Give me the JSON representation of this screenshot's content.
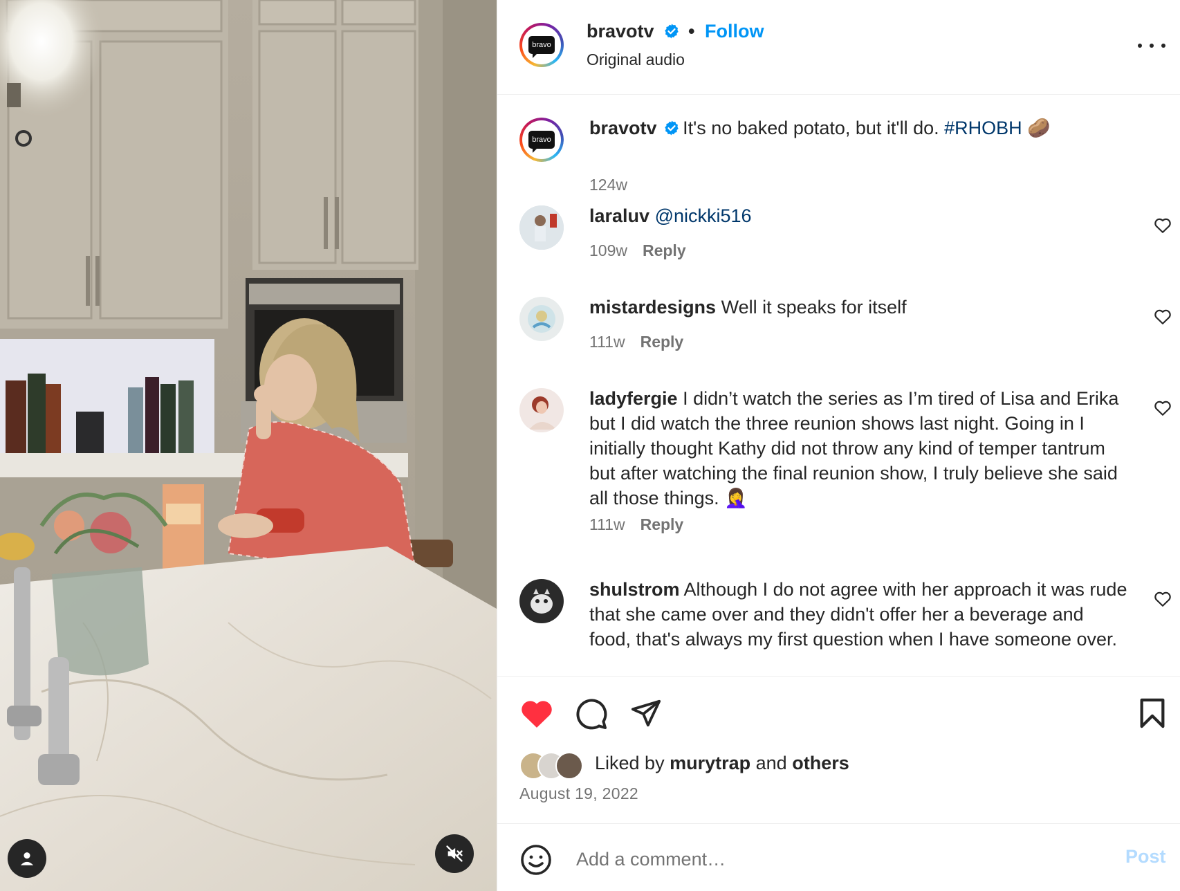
{
  "header": {
    "username": "bravotv",
    "separator": "•",
    "follow_label": "Follow",
    "subtitle": "Original audio",
    "avatar_text": "bravo"
  },
  "caption": {
    "username": "bravotv",
    "text": "It's no baked potato, but it'll do.",
    "hashtag": "#RHOBH",
    "emoji": "🥔",
    "time": "124w"
  },
  "comments": [
    {
      "username": "laraluv",
      "mention": "@nickki516",
      "text": "",
      "time": "109w",
      "reply_label": "Reply"
    },
    {
      "username": "mistardesigns",
      "text": "Well it speaks for itself",
      "time": "111w",
      "reply_label": "Reply"
    },
    {
      "username": "ladyfergie",
      "text": "I didn’t watch the series as I’m tired of Lisa and Erika but I did watch the three reunion shows last night. Going in I initially thought Kathy did not throw any kind of temper tantrum but after watching the final reunion show, I truly believe she said all those things. 🤦‍♀️",
      "time": "111w",
      "reply_label": "Reply"
    },
    {
      "username": "shulstrom",
      "text": "Although I do not agree with her approach it was rude that she came over and they didn't offer her a beverage and food, that's always my first question when I have someone over.",
      "time": "",
      "reply_label": ""
    }
  ],
  "likes": {
    "prefix": "Liked by",
    "user": "murytrap",
    "middle": "and",
    "others": "others"
  },
  "post_date": "August 19, 2022",
  "composer": {
    "placeholder": "Add a comment…",
    "post_label": "Post"
  },
  "icons": {
    "verified": "verified-badge-icon",
    "like": "heart-filled-icon",
    "comment": "comment-bubble-icon",
    "share": "paper-plane-icon",
    "save": "bookmark-icon",
    "more": "more-options-icon",
    "emoji": "smiley-icon",
    "tag": "user-tag-icon",
    "mute": "speaker-muted-icon"
  },
  "colors": {
    "accent_blue": "#0095f6",
    "like_red": "#ff3040",
    "link_blue": "#00376b",
    "muted_text": "#737373",
    "post_disabled": "#b3dbff"
  }
}
